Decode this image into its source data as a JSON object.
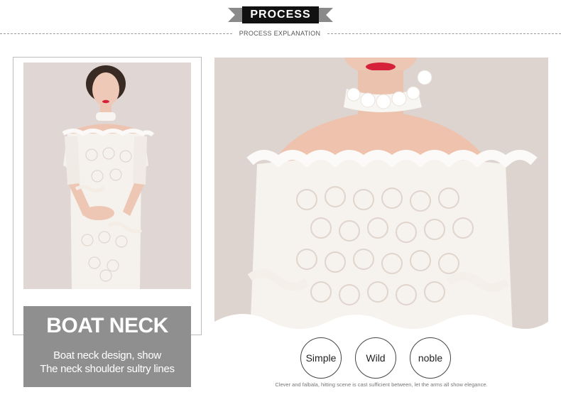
{
  "header": {
    "title": "PROCESS",
    "subtitle": "PROCESS EXPLANATION"
  },
  "caption": {
    "heading": "BOAT NECK",
    "line1": "Boat neck design, show",
    "line2": "The neck shoulder sultry lines"
  },
  "tags": [
    "Simple",
    "Wild",
    "noble"
  ],
  "footnote": "Clever and falbala, hitting scene is cast sufficient between, let the arms all show elegance.",
  "colors": {
    "banner": "#111111",
    "caption_bg": "#8f8f8f",
    "photo_bg": "#ddd3cf",
    "lips": "#d6213a"
  }
}
